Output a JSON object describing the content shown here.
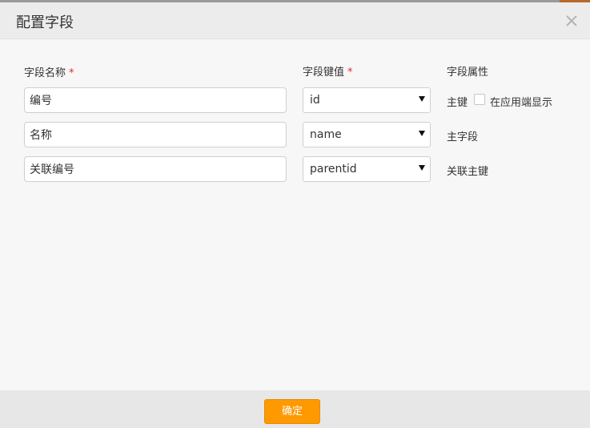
{
  "dialog": {
    "title": "配置字段",
    "close_icon": "close-icon"
  },
  "columns": {
    "field_name": "字段名称",
    "field_key": "字段键值",
    "field_attr": "字段属性",
    "required_mark": "*"
  },
  "rows": [
    {
      "name": "编号",
      "key": "id",
      "attr": "主键",
      "checkbox_label": "在应用端显示",
      "checked": false
    },
    {
      "name": "名称",
      "key": "name",
      "attr": "主字段"
    },
    {
      "name": "关联编号",
      "key": "parentid",
      "attr": "关联主键"
    }
  ],
  "footer": {
    "ok_label": "确定",
    "ok_color": "#ff9900"
  }
}
